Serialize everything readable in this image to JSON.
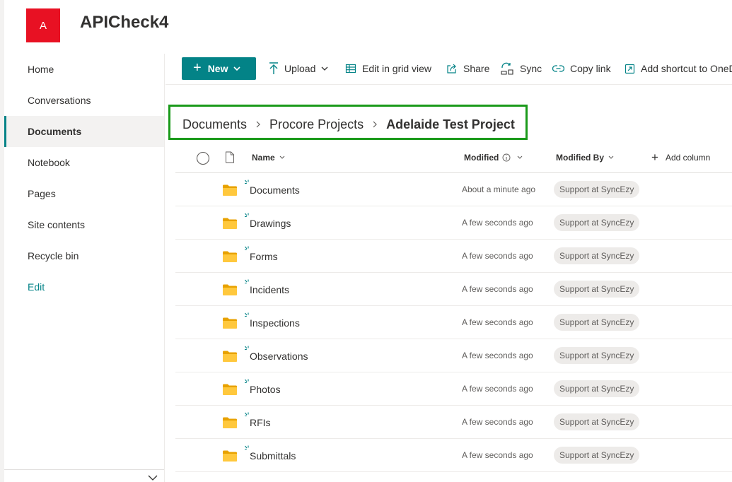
{
  "site": {
    "logo_letter": "A",
    "title": "APICheck4"
  },
  "nav": {
    "items": [
      {
        "label": "Home"
      },
      {
        "label": "Conversations"
      },
      {
        "label": "Documents",
        "active": true
      },
      {
        "label": "Notebook"
      },
      {
        "label": "Pages"
      },
      {
        "label": "Site contents"
      },
      {
        "label": "Recycle bin"
      }
    ],
    "edit_label": "Edit"
  },
  "commandbar": {
    "new_label": "New",
    "upload_label": "Upload",
    "grid_label": "Edit in grid view",
    "share_label": "Share",
    "sync_label": "Sync",
    "copylink_label": "Copy link",
    "shortcut_label": "Add shortcut to OneDrive"
  },
  "breadcrumb": [
    "Documents",
    "Procore Projects",
    "Adelaide Test Project"
  ],
  "list": {
    "columns": {
      "name": "Name",
      "modified": "Modified",
      "modified_by": "Modified By",
      "add_column": "Add column"
    },
    "rows": [
      {
        "name": "Documents",
        "modified": "About a minute ago",
        "modified_by": "Support at SyncEzy"
      },
      {
        "name": "Drawings",
        "modified": "A few seconds ago",
        "modified_by": "Support at SyncEzy"
      },
      {
        "name": "Forms",
        "modified": "A few seconds ago",
        "modified_by": "Support at SyncEzy"
      },
      {
        "name": "Incidents",
        "modified": "A few seconds ago",
        "modified_by": "Support at SyncEzy"
      },
      {
        "name": "Inspections",
        "modified": "A few seconds ago",
        "modified_by": "Support at SyncEzy"
      },
      {
        "name": "Observations",
        "modified": "A few seconds ago",
        "modified_by": "Support at SyncEzy"
      },
      {
        "name": "Photos",
        "modified": "A few seconds ago",
        "modified_by": "Support at SyncEzy"
      },
      {
        "name": "RFIs",
        "modified": "A few seconds ago",
        "modified_by": "Support at SyncEzy"
      },
      {
        "name": "Submittals",
        "modified": "A few seconds ago",
        "modified_by": "Support at SyncEzy"
      }
    ]
  },
  "colors": {
    "accent": "#038387",
    "highlight_box": "#1a9a1a",
    "site_logo": "#e81123",
    "folder": "#ffb900"
  }
}
